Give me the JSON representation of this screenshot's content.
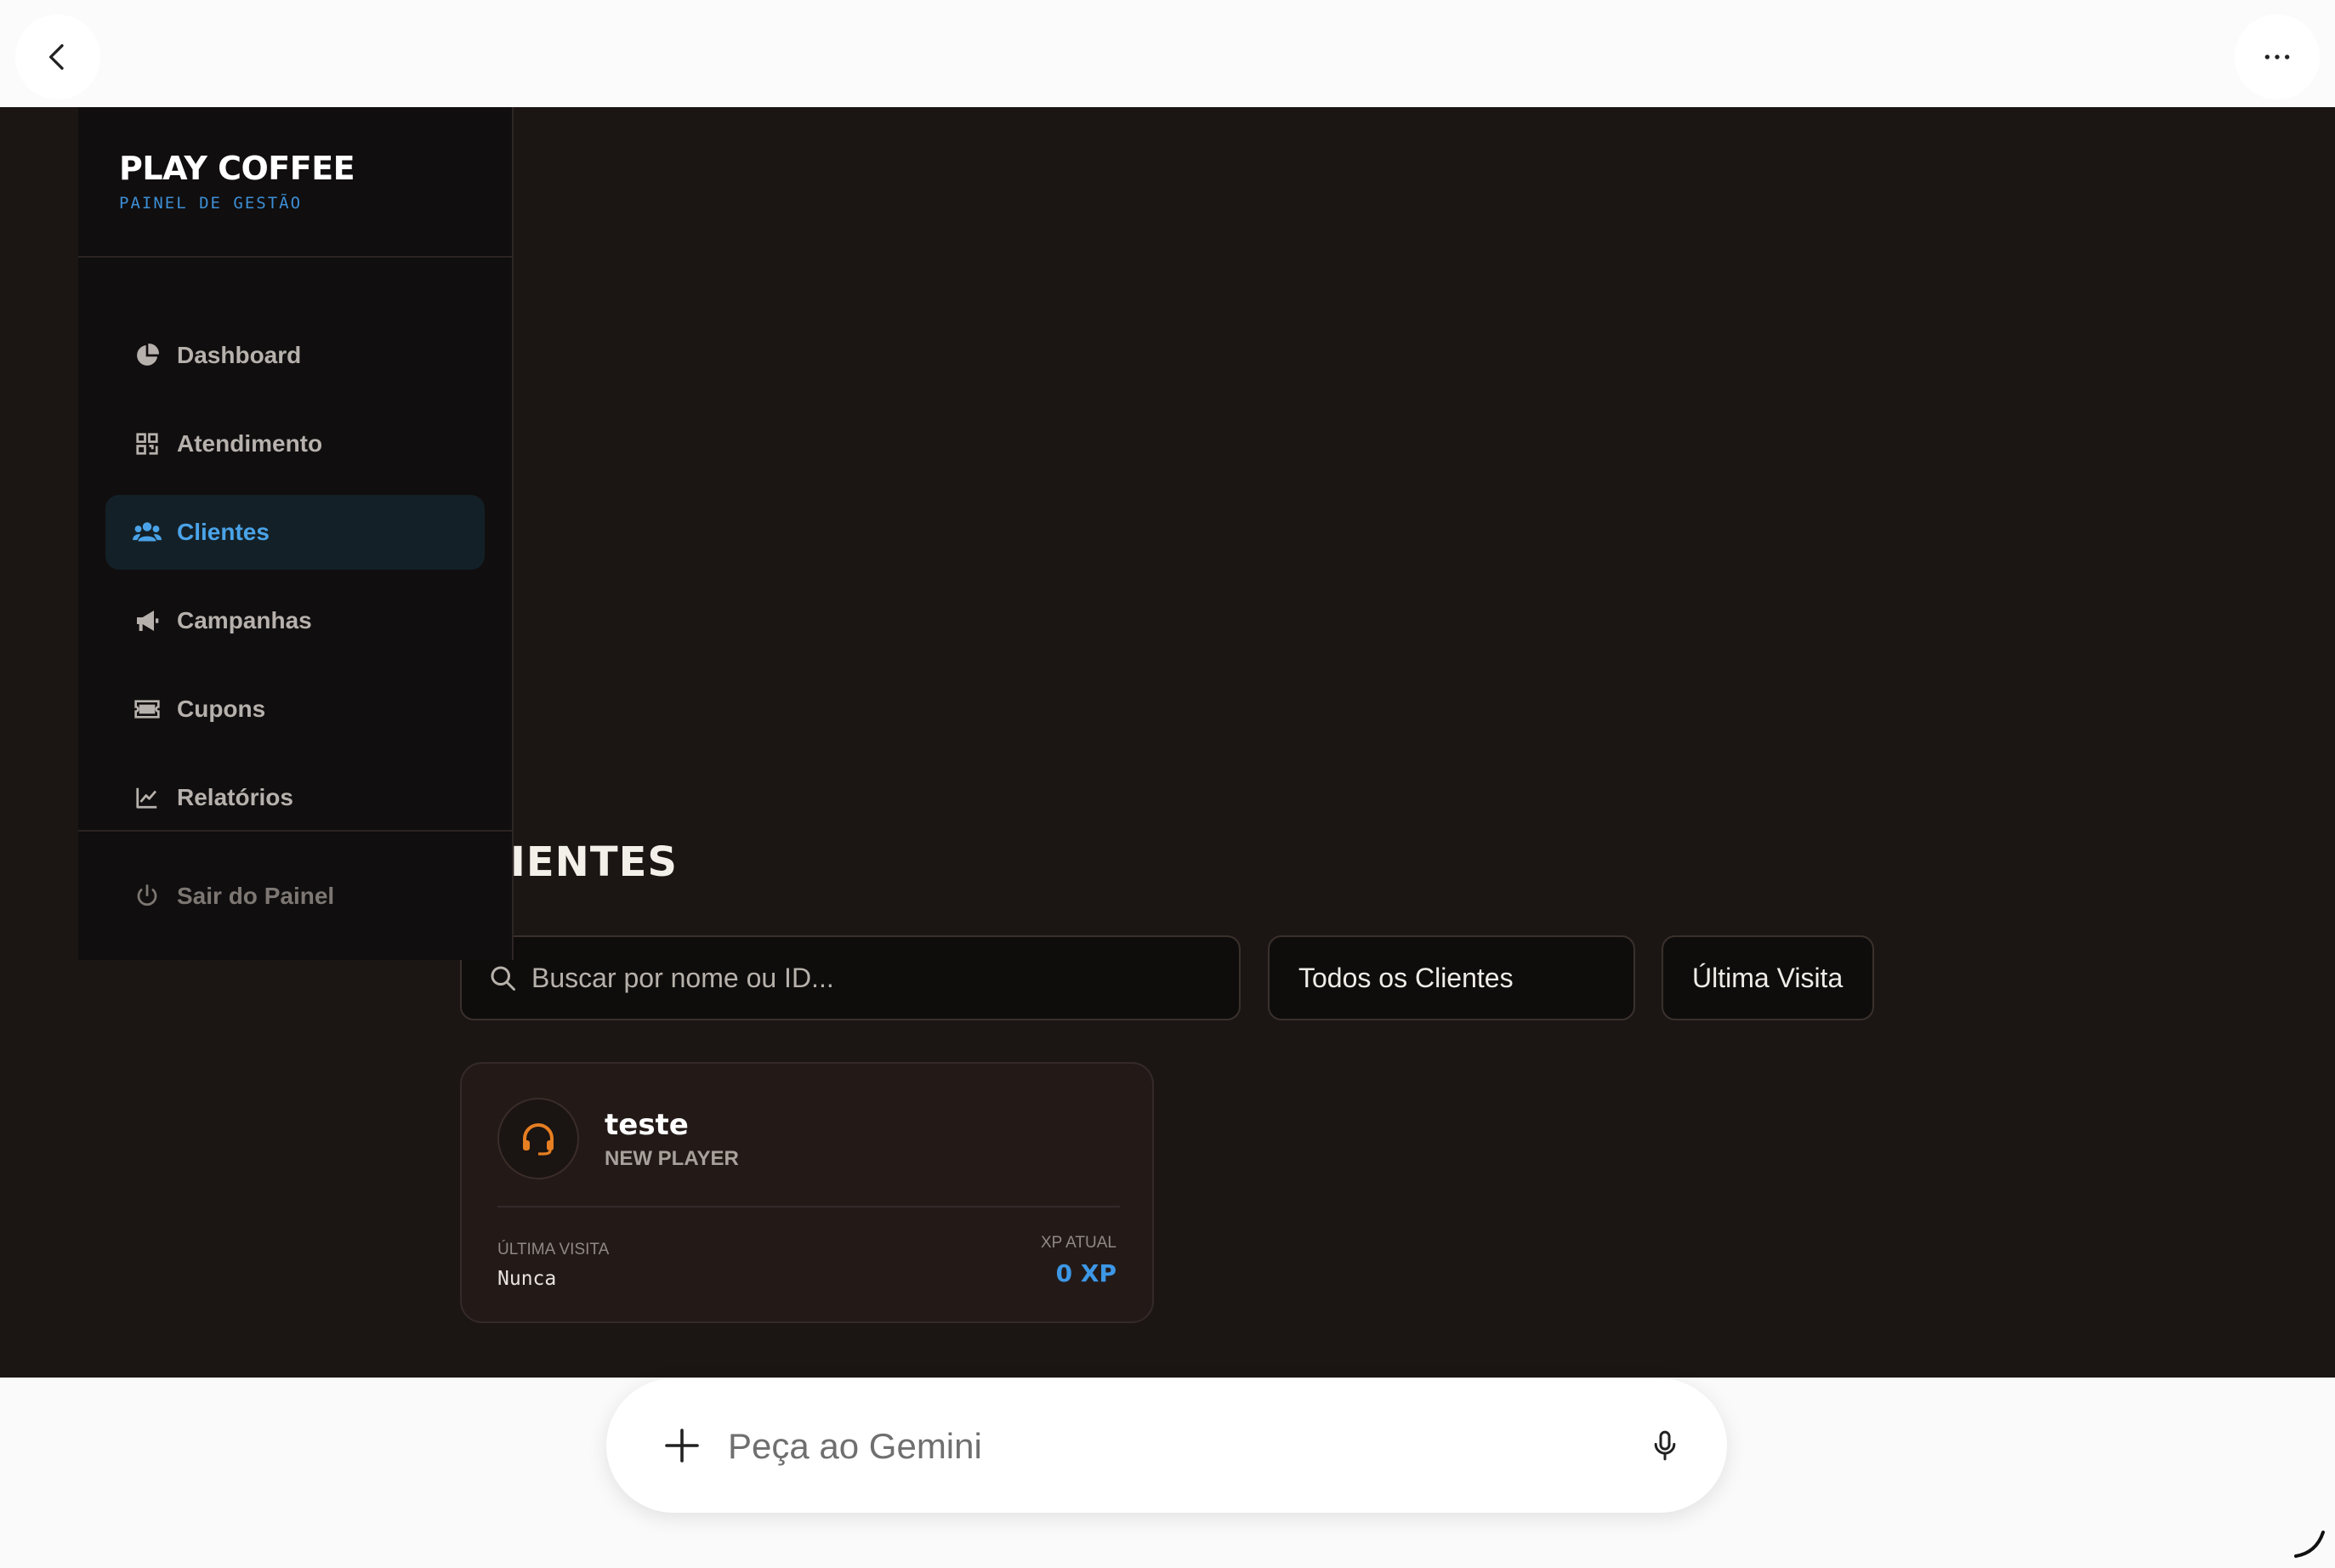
{
  "app": {
    "brand": "PLAY COFFEE",
    "brand_sub": "PAINEL DE GESTÃO",
    "page_title": "IENTES"
  },
  "sidebar": {
    "items": [
      {
        "label": "Dashboard",
        "icon": "pie-chart-icon"
      },
      {
        "label": "Atendimento",
        "icon": "qr-code-icon"
      },
      {
        "label": "Clientes",
        "icon": "users-icon",
        "active": true
      },
      {
        "label": "Campanhas",
        "icon": "megaphone-icon"
      },
      {
        "label": "Cupons",
        "icon": "ticket-icon"
      },
      {
        "label": "Relatórios",
        "icon": "line-chart-icon"
      }
    ],
    "logout": {
      "label": "Sair do Painel",
      "icon": "power-icon"
    }
  },
  "search": {
    "placeholder": "Buscar por nome ou ID..."
  },
  "filters": {
    "all_clients": "Todos os Clientes",
    "last_visit": "Última Visita"
  },
  "client_card": {
    "name": "teste",
    "rank": "NEW PLAYER",
    "last_visit_label": "ÚLTIMA VISITA",
    "last_visit_value": "Nunca",
    "xp_label": "XP ATUAL",
    "xp_value": "0 XP",
    "icon": "headset-icon"
  },
  "gemini": {
    "placeholder": "Peça ao Gemini"
  },
  "colors": {
    "accent_blue": "#3d97e6",
    "avatar_orange": "#e67e22",
    "background_dark": "#1b1614",
    "sidebar_bg": "#100e0e"
  }
}
